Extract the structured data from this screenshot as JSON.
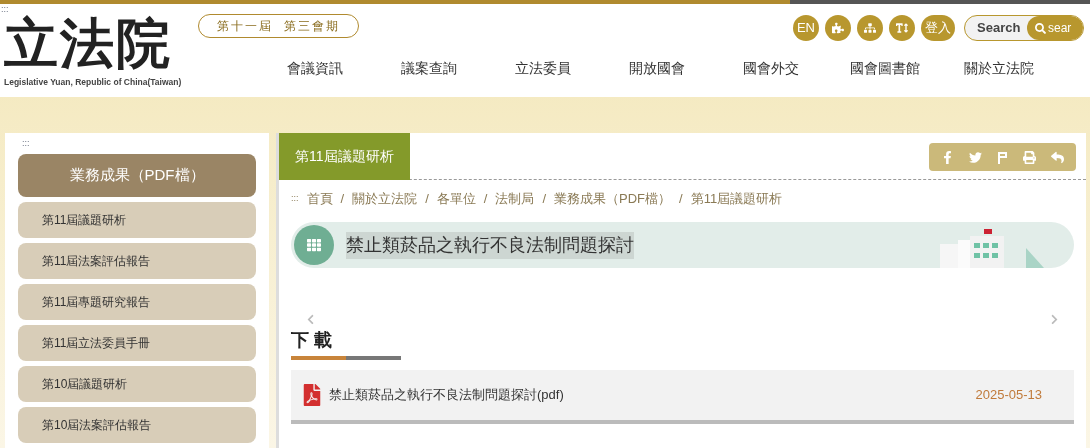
{
  "header": {
    "accesskey": ":::",
    "logo": "立法院",
    "logo_subtitle": "Legislative Yuan, Republic of China(Taiwan)",
    "session": "第十一屆  第三會期",
    "tools": [
      {
        "kind": "text",
        "label": "EN"
      },
      {
        "kind": "puzzle"
      },
      {
        "kind": "sitemap"
      },
      {
        "kind": "fontsize"
      },
      {
        "kind": "text",
        "label": "登入"
      }
    ],
    "search": {
      "placeholder": "Search",
      "button": "sear"
    },
    "nav": [
      "會議資訊",
      "議案查詢",
      "立法委員",
      "開放國會",
      "國會外交",
      "國會圖書館",
      "關於立法院"
    ]
  },
  "sidebar": {
    "accesskey": ":::",
    "heading": "業務成果（PDF檔）",
    "items": [
      {
        "label": "第11屆議題研析"
      },
      {
        "label": "第11屆法案評估報告"
      },
      {
        "label": "第11屆專題研究報告"
      },
      {
        "label": "第11屆立法委員手冊"
      },
      {
        "label": "第10屆議題研析"
      },
      {
        "label": "第10屆法案評估報告"
      }
    ]
  },
  "main": {
    "tab": "第11屆議題研析",
    "share": [
      {
        "kind": "facebook"
      },
      {
        "kind": "twitter"
      },
      {
        "kind": "plurk"
      },
      {
        "kind": "print"
      },
      {
        "kind": "back"
      }
    ],
    "breadcrumb": {
      "accesskey": ":::",
      "separator": "/",
      "items": [
        "首頁",
        "關於立法院",
        "各單位",
        "法制局",
        "業務成果（PDF檔）",
        "第11屆議題研析"
      ]
    },
    "title": "禁止類菸品之執行不良法制問題探討",
    "download_heading": "下 載",
    "files": [
      {
        "name": "禁止類菸品之執行不良法制問題探討(pdf)",
        "date": "2025-05-13"
      }
    ]
  }
}
